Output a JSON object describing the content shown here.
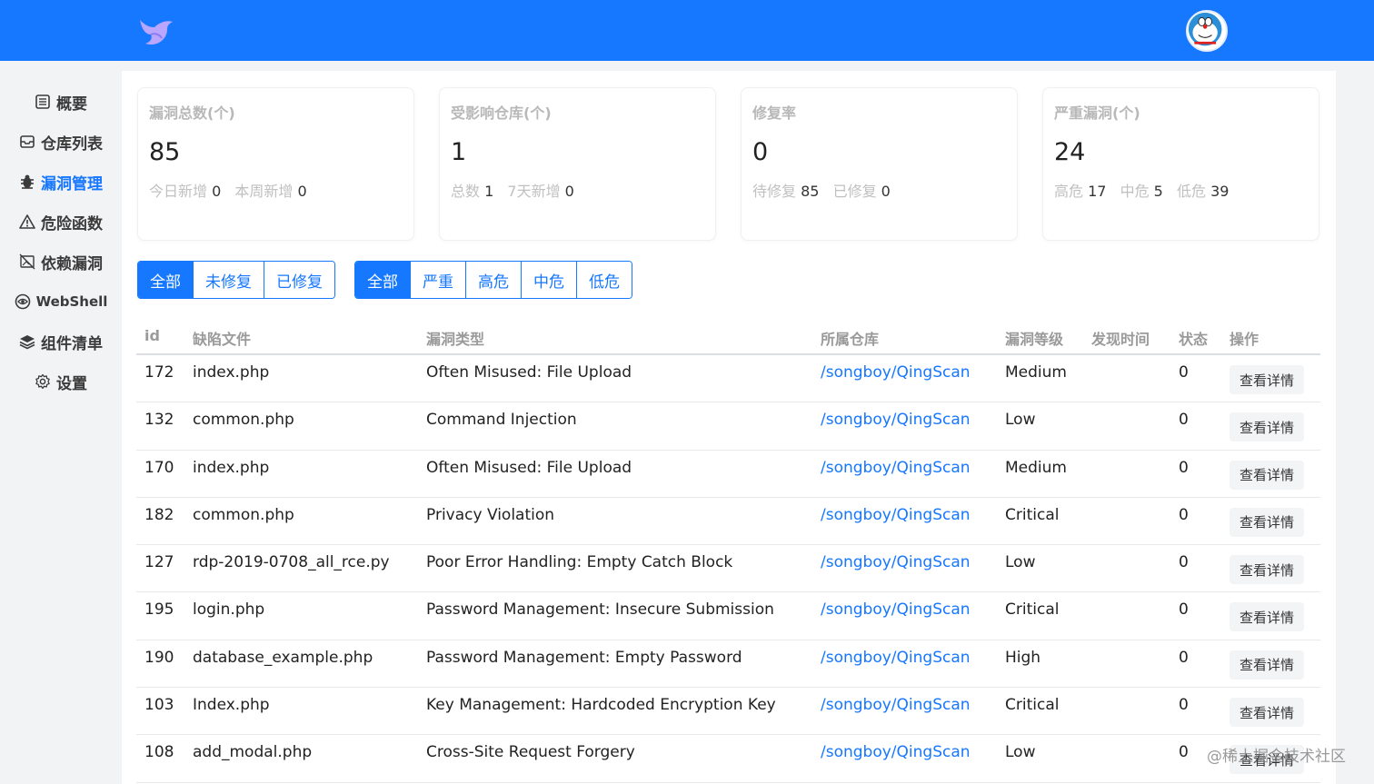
{
  "header": {
    "logo_icon": "bird-logo-icon",
    "avatar_icon": "doraemon-avatar-icon",
    "bg_color": "#1677ff"
  },
  "sidebar": {
    "items": [
      {
        "label": "概要",
        "icon": "list-icon"
      },
      {
        "label": "仓库列表",
        "icon": "inbox-icon"
      },
      {
        "label": "漏洞管理",
        "icon": "bug-icon",
        "active": true
      },
      {
        "label": "危险函数",
        "icon": "warning-icon"
      },
      {
        "label": "依赖漏洞",
        "icon": "no-image-icon"
      },
      {
        "label": "WebShell",
        "icon": "eye-icon"
      },
      {
        "label": "组件清单",
        "icon": "layers-icon"
      },
      {
        "label": "设置",
        "icon": "gear-icon"
      }
    ]
  },
  "cards": [
    {
      "title": "漏洞总数(个)",
      "value": "85",
      "sub": [
        {
          "label": "今日新增",
          "value": "0"
        },
        {
          "label": "本周新增",
          "value": "0"
        }
      ]
    },
    {
      "title": "受影响仓库(个)",
      "value": "1",
      "sub": [
        {
          "label": "总数",
          "value": "1"
        },
        {
          "label": "7天新增",
          "value": "0"
        }
      ]
    },
    {
      "title": "修复率",
      "value": "0",
      "sub": [
        {
          "label": "待修复",
          "value": "85"
        },
        {
          "label": "已修复",
          "value": "0"
        }
      ]
    },
    {
      "title": "严重漏洞(个)",
      "value": "24",
      "sub": [
        {
          "label": "高危",
          "value": "17"
        },
        {
          "label": "中危",
          "value": "5"
        },
        {
          "label": "低危",
          "value": "39"
        }
      ]
    }
  ],
  "filters": {
    "status": [
      "全部",
      "未修复",
      "已修复"
    ],
    "status_selected": "全部",
    "level": [
      "全部",
      "严重",
      "高危",
      "中危",
      "低危"
    ],
    "level_selected": "全部"
  },
  "table": {
    "columns": [
      "id",
      "缺陷文件",
      "漏洞类型",
      "所属仓库",
      "漏洞等级",
      "发现时间",
      "状态",
      "操作"
    ],
    "action_label": "查看详情",
    "rows": [
      {
        "id": "172",
        "file": "index.php",
        "type": "Often Misused: File Upload",
        "repo": "/songboy/QingScan",
        "level": "Medium",
        "time": "",
        "status": "0"
      },
      {
        "id": "132",
        "file": "common.php",
        "type": "Command Injection",
        "repo": "/songboy/QingScan",
        "level": "Low",
        "time": "",
        "status": "0"
      },
      {
        "id": "170",
        "file": "index.php",
        "type": "Often Misused: File Upload",
        "repo": "/songboy/QingScan",
        "level": "Medium",
        "time": "",
        "status": "0"
      },
      {
        "id": "182",
        "file": "common.php",
        "type": "Privacy Violation",
        "repo": "/songboy/QingScan",
        "level": "Critical",
        "time": "",
        "status": "0"
      },
      {
        "id": "127",
        "file": "rdp-2019-0708_all_rce.py",
        "type": "Poor Error Handling: Empty Catch Block",
        "repo": "/songboy/QingScan",
        "level": "Low",
        "time": "",
        "status": "0"
      },
      {
        "id": "195",
        "file": "login.php",
        "type": "Password Management: Insecure Submission",
        "repo": "/songboy/QingScan",
        "level": "Critical",
        "time": "",
        "status": "0"
      },
      {
        "id": "190",
        "file": "database_example.php",
        "type": "Password Management: Empty Password",
        "repo": "/songboy/QingScan",
        "level": "High",
        "time": "",
        "status": "0"
      },
      {
        "id": "103",
        "file": "Index.php",
        "type": "Key Management: Hardcoded Encryption Key",
        "repo": "/songboy/QingScan",
        "level": "Critical",
        "time": "",
        "status": "0"
      },
      {
        "id": "108",
        "file": "add_modal.php",
        "type": "Cross-Site Request Forgery",
        "repo": "/songboy/QingScan",
        "level": "Low",
        "time": "",
        "status": "0"
      }
    ]
  },
  "watermark": "@稀土掘金技术社区"
}
